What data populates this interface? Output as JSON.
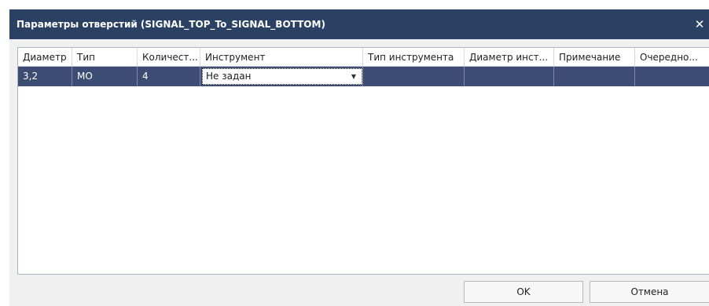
{
  "window": {
    "title": "Параметры отверстий (SIGNAL_TOP_To_SIGNAL_BOTTOM)",
    "close_glyph": "✕"
  },
  "table": {
    "columns": [
      "Диаметр",
      "Тип",
      "Количест...",
      "Инструмент",
      "Тип инструмента",
      "Диаметр инст...",
      "Примечание",
      "Очередно..."
    ],
    "rows": [
      {
        "diameter": "3,2",
        "type": "MO",
        "count": "4",
        "tool": "Не задан",
        "tool_type": "",
        "tool_diameter": "",
        "note": "",
        "order": ""
      }
    ]
  },
  "combo_arrow": "▼",
  "buttons": {
    "ok": "OK",
    "cancel": "Отмена"
  },
  "colors": {
    "titlebar": "#2b4163",
    "selected_row": "#3d4c72",
    "dialog_bg": "#f0f0f0"
  }
}
